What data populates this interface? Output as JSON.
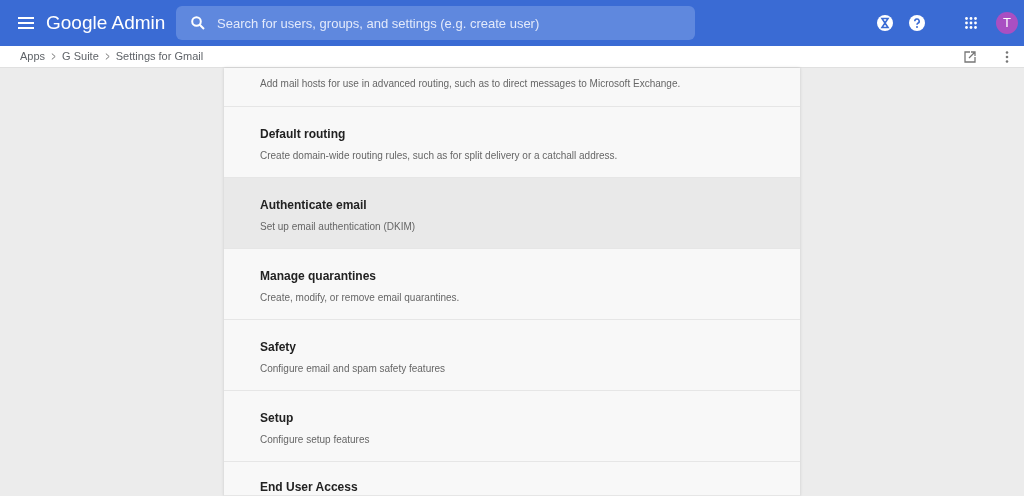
{
  "header": {
    "logo": "Google Admin",
    "search": {
      "placeholder": "Search for users, groups, and settings (e.g. create user)"
    },
    "avatar": "T"
  },
  "breadcrumb": [
    "Apps",
    "G Suite",
    "Settings for Gmail"
  ],
  "settings": [
    {
      "description": "Add mail hosts for use in advanced routing, such as to direct messages to Microsoft Exchange.",
      "selected": false
    },
    {
      "title": "Default routing",
      "description": "Create domain-wide routing rules, such as for split delivery or a catchall address.",
      "selected": false
    },
    {
      "title": "Authenticate email",
      "description": "Set up email authentication (DKIM)",
      "selected": true
    },
    {
      "title": "Manage quarantines",
      "description": "Create, modify, or remove email quarantines.",
      "selected": false
    },
    {
      "title": "Safety",
      "description": "Configure email and spam safety features",
      "selected": false
    },
    {
      "title": "Setup",
      "description": "Configure setup features",
      "selected": false
    },
    {
      "title": "End User Access",
      "selected": false
    }
  ]
}
